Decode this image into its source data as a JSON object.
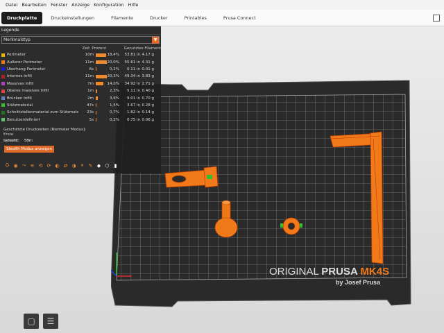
{
  "menu": [
    "Datei",
    "Bearbeiten",
    "Fenster",
    "Anzeige",
    "Konfiguration",
    "Hilfe"
  ],
  "tabs": [
    {
      "label": "Druckplatte",
      "active": true
    },
    {
      "label": "Druckeinstellungen",
      "active": false
    },
    {
      "label": "Filamente",
      "active": false
    },
    {
      "label": "Drucker",
      "active": false
    },
    {
      "label": "Printables",
      "active": false
    },
    {
      "label": "Prusa Connect",
      "active": false
    }
  ],
  "legend": {
    "title": "Legende",
    "feature_type_label": "Merkmalstyp",
    "headers": {
      "time": "Zeit",
      "percent": "Prozent",
      "used": "Genutztes Filament"
    },
    "rows": [
      {
        "label": "Perimeter",
        "color": "#e8b400",
        "time": "10m",
        "pct": "18,4%",
        "length": "53.81 in",
        "weight": "4.17 g",
        "fraction": 0.184
      },
      {
        "label": "Äußerer Perimeter",
        "color": "#f07a1a",
        "time": "11m",
        "pct": "20,0%",
        "length": "55.61 in",
        "weight": "4.31 g",
        "fraction": 0.2
      },
      {
        "label": "Überhang Perimeter",
        "color": "#1a1ae0",
        "time": "6s",
        "pct": "0,2%",
        "length": "0.11 in",
        "weight": "0.01 g",
        "fraction": 0.002
      },
      {
        "label": "Internes Infill",
        "color": "#b0202a",
        "time": "11m",
        "pct": "20,3%",
        "length": "49.34 in",
        "weight": "3.83 g",
        "fraction": 0.203
      },
      {
        "label": "Massives Infill",
        "color": "#b040c0",
        "time": "7m",
        "pct": "14,0%",
        "length": "34.92 in",
        "weight": "2.71 g",
        "fraction": 0.14
      },
      {
        "label": "Oberes massives Infill",
        "color": "#e04040",
        "time": "1m",
        "pct": "2,3%",
        "length": "5.11 in",
        "weight": "0.40 g",
        "fraction": 0.023
      },
      {
        "label": "Brücken Infill",
        "color": "#6080c0",
        "time": "2m",
        "pct": "3,6%",
        "length": "9.01 in",
        "weight": "0.70 g",
        "fraction": 0.036
      },
      {
        "label": "Stützmaterial",
        "color": "#30c030",
        "time": "47s",
        "pct": "1,5%",
        "length": "3.67 in",
        "weight": "0.28 g",
        "fraction": 0.015
      },
      {
        "label": "Schnittstellenmaterial zum Stützmaterial",
        "color": "#207020",
        "time": "23s",
        "pct": "0,7%",
        "length": "1.82 in",
        "weight": "0.14 g",
        "fraction": 0.007
      },
      {
        "label": "Benutzerdefiniert",
        "color": "#60c070",
        "time": "5s",
        "pct": "0,2%",
        "length": "0.75 in",
        "weight": "0.06 g",
        "fraction": 0.002
      }
    ],
    "times_title": "Geschätzte Druckzeiten [Normaler Modus]:",
    "first_layer_label": "Erste Schicht:",
    "first_layer_value": "3m",
    "total_label": "Gesamt:",
    "total_value": "53m",
    "stealth_button": "Stealth Modus anzeigen"
  },
  "bed": {
    "brand_original": "ORIGINAL ",
    "brand_prusa": "PRUSA ",
    "brand_model": "MK4S",
    "byline": "by Josef Prusa"
  },
  "colors": {
    "accent": "#e86a2b",
    "model": "#f07a1a",
    "bed": "#2a2a2a"
  },
  "icons": [
    "shells-icon",
    "tool-marker-icon",
    "travel-icon",
    "wipe-icon",
    "retractions-icon",
    "deretractions-icon",
    "seams-icon",
    "tool-changes-icon",
    "color-changes-icon",
    "pause-icon",
    "custom-gcode-icon",
    "center-of-gravity-icon",
    "sequential-icon",
    "shape-icon"
  ]
}
